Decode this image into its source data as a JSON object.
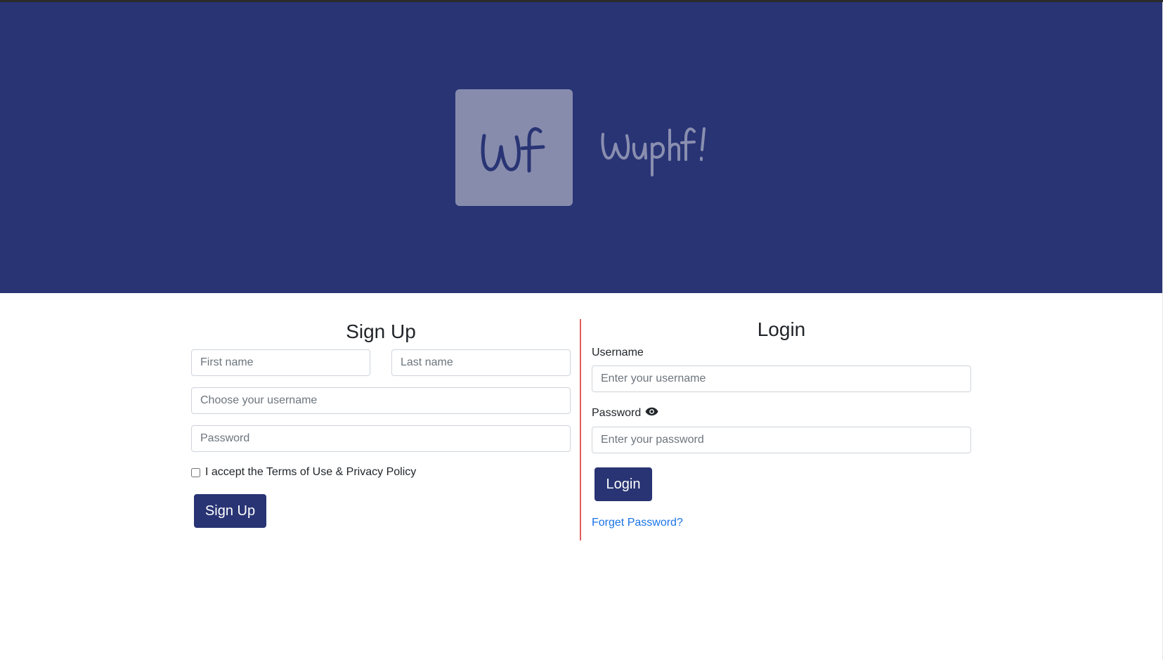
{
  "brand": {
    "logo_mark": "Wf",
    "wordmark": "Wuphf!",
    "colors": {
      "hero_bg": "#293474",
      "logo_tile": "#878cad",
      "primary": "#293474",
      "divider": "#e05c5c",
      "link": "#1a73e8"
    }
  },
  "signup": {
    "title": "Sign Up",
    "first_name_placeholder": "First name",
    "last_name_placeholder": "Last name",
    "username_placeholder": "Choose your username",
    "password_placeholder": "Password",
    "terms_label": "I accept the Terms of Use & Privacy Policy",
    "terms_checked": false,
    "submit_label": "Sign Up"
  },
  "login": {
    "title": "Login",
    "username_label": "Username",
    "username_placeholder": "Enter your username",
    "password_label": "Password",
    "password_toggle_icon": "eye-icon",
    "password_placeholder": "Enter your password",
    "submit_label": "Login",
    "forgot_link": "Forget Password?"
  }
}
